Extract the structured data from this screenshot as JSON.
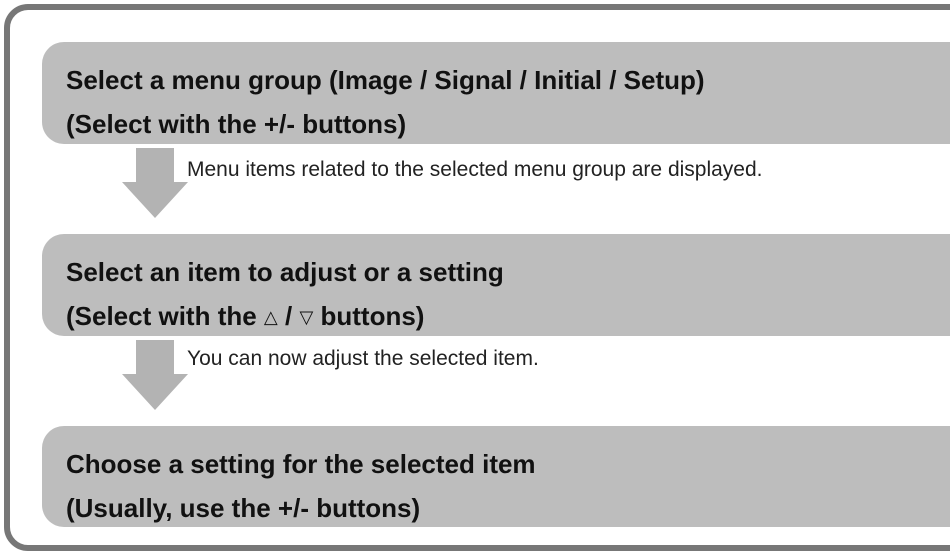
{
  "steps": [
    {
      "line1": "Select a menu group (Image / Signal / Initial / Setup)",
      "line2": "(Select with the +/- buttons)"
    },
    {
      "line1": "Select an item to adjust or a setting",
      "line2_prefix": "(Select with the ",
      "up_symbol": "△",
      "separator": " / ",
      "down_symbol": "▽",
      "line2_suffix": " buttons)"
    },
    {
      "line1": "Choose a setting for the selected item",
      "line2": "(Usually, use the +/- buttons)"
    }
  ],
  "notes": [
    "Menu items related to the selected menu group are displayed.",
    "You can now adjust the selected item."
  ],
  "colors": {
    "border": "#777777",
    "step_fill": "#bdbdbd",
    "arrow_fill": "#b3b3b3"
  }
}
